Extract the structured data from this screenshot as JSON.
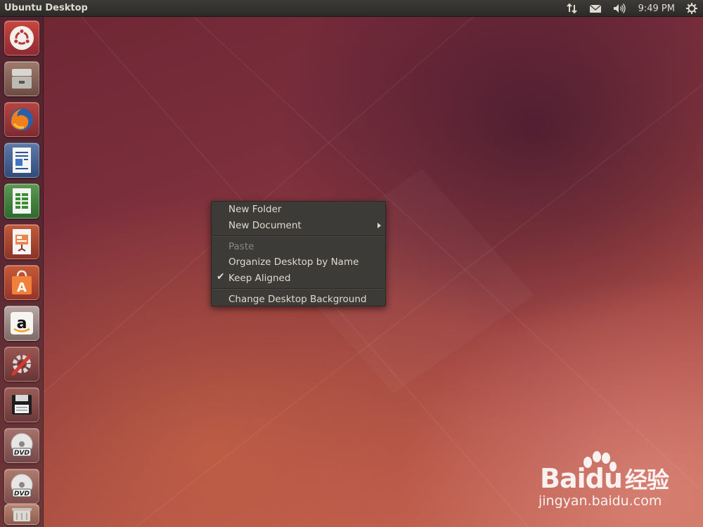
{
  "top_panel": {
    "title": "Ubuntu Desktop",
    "clock": "9:49 PM",
    "indicators": [
      "network-icon",
      "mail-icon",
      "volume-icon",
      "system-gear-icon"
    ]
  },
  "launcher": {
    "items": [
      {
        "name": "dash-home",
        "icon": "ubuntu-logo-icon"
      },
      {
        "name": "files",
        "icon": "file-cabinet-icon"
      },
      {
        "name": "firefox",
        "icon": "firefox-icon"
      },
      {
        "name": "libreoffice-writer",
        "icon": "writer-icon"
      },
      {
        "name": "libreoffice-calc",
        "icon": "calc-icon"
      },
      {
        "name": "libreoffice-impress",
        "icon": "impress-icon"
      },
      {
        "name": "software-center",
        "icon": "shopping-bag-icon"
      },
      {
        "name": "amazon",
        "icon": "amazon-icon"
      },
      {
        "name": "system-settings",
        "icon": "settings-tools-icon"
      },
      {
        "name": "save-floppy",
        "icon": "floppy-disk-icon"
      },
      {
        "name": "dvd-1",
        "icon": "dvd-icon",
        "label": "DVD"
      },
      {
        "name": "dvd-2",
        "icon": "dvd-icon",
        "label": "DVD"
      },
      {
        "name": "trash",
        "icon": "trash-icon"
      }
    ]
  },
  "context_menu": {
    "new_folder": "New Folder",
    "new_document": "New Document",
    "paste": "Paste",
    "organize": "Organize Desktop by Name",
    "keep_aligned": "Keep Aligned",
    "keep_aligned_checked": true,
    "change_background": "Change Desktop Background"
  },
  "watermark": {
    "brand": "Bai",
    "brand_suffix": "du",
    "chinese": "经验",
    "url": "jingyan.baidu.com"
  },
  "colors": {
    "panel": "#3c3b37",
    "menu_bg": "#3c3b37",
    "menu_text": "#dfdbd2",
    "disabled_text": "#8a8780",
    "ubuntu_orange": "#dd4814"
  }
}
